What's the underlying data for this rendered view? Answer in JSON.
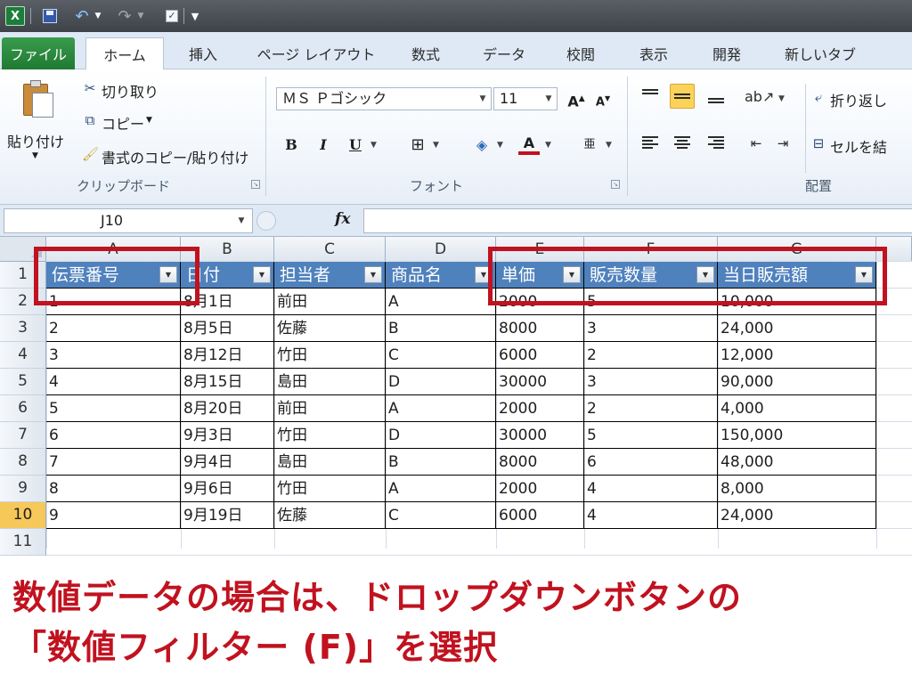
{
  "quick_access": {
    "app_icon": "X",
    "icons": [
      "excel-icon",
      "save-icon",
      "undo-icon",
      "redo-icon",
      "checkbox-icon",
      "customize-icon"
    ]
  },
  "tabs": [
    {
      "label": "ファイル"
    },
    {
      "label": "ホーム"
    },
    {
      "label": "挿入"
    },
    {
      "label": "ページ レイアウト"
    },
    {
      "label": "数式"
    },
    {
      "label": "データ"
    },
    {
      "label": "校閲"
    },
    {
      "label": "表示"
    },
    {
      "label": "開発"
    },
    {
      "label": "新しいタブ"
    }
  ],
  "ribbon": {
    "clipboard": {
      "paste": "貼り付け",
      "cut": "切り取り",
      "copy": "コピー",
      "format_painter": "書式のコピー/貼り付け",
      "group_label": "クリップボード"
    },
    "font": {
      "font_name": "ＭＳ Ｐゴシック",
      "font_size": "11",
      "bold": "B",
      "italic": "I",
      "underline": "U",
      "font_color": "A",
      "group_label": "フォント"
    },
    "alignment": {
      "wrap_text": "折り返し",
      "merge": "セルを結",
      "group_label": "配置"
    }
  },
  "formula_bar": {
    "name_box": "J10",
    "fx": "fx",
    "formula": ""
  },
  "sheet": {
    "columns": [
      "A",
      "B",
      "C",
      "D",
      "E",
      "F",
      "G"
    ],
    "rows": [
      "1",
      "2",
      "3",
      "4",
      "5",
      "6",
      "7",
      "8",
      "9",
      "10",
      "11"
    ],
    "selected_row": "10",
    "header": [
      "伝票番号",
      "日付",
      "担当者",
      "商品名",
      "単価",
      "販売数量",
      "当日販売額"
    ],
    "data": [
      [
        "1",
        "8月1日",
        "前田",
        "A",
        "2000",
        "5",
        "10,000"
      ],
      [
        "2",
        "8月5日",
        "佐藤",
        "B",
        "8000",
        "3",
        "24,000"
      ],
      [
        "3",
        "8月12日",
        "竹田",
        "C",
        "6000",
        "2",
        "12,000"
      ],
      [
        "4",
        "8月15日",
        "島田",
        "D",
        "30000",
        "3",
        "90,000"
      ],
      [
        "5",
        "8月20日",
        "前田",
        "A",
        "2000",
        "2",
        "4,000"
      ],
      [
        "6",
        "9月3日",
        "竹田",
        "D",
        "30000",
        "5",
        "150,000"
      ],
      [
        "7",
        "9月4日",
        "島田",
        "B",
        "8000",
        "6",
        "48,000"
      ],
      [
        "8",
        "9月6日",
        "竹田",
        "A",
        "2000",
        "4",
        "8,000"
      ],
      [
        "9",
        "9月19日",
        "佐藤",
        "C",
        "6000",
        "4",
        "24,000"
      ]
    ]
  },
  "caption": {
    "line1": "数値データの場合は、ドロップダウンボタンの",
    "line2": "「数値フィルター (F)」を選択"
  },
  "colors": {
    "header_fill": "#4f81bd",
    "highlight": "#c1121f",
    "file_tab": "#1f7a33"
  }
}
